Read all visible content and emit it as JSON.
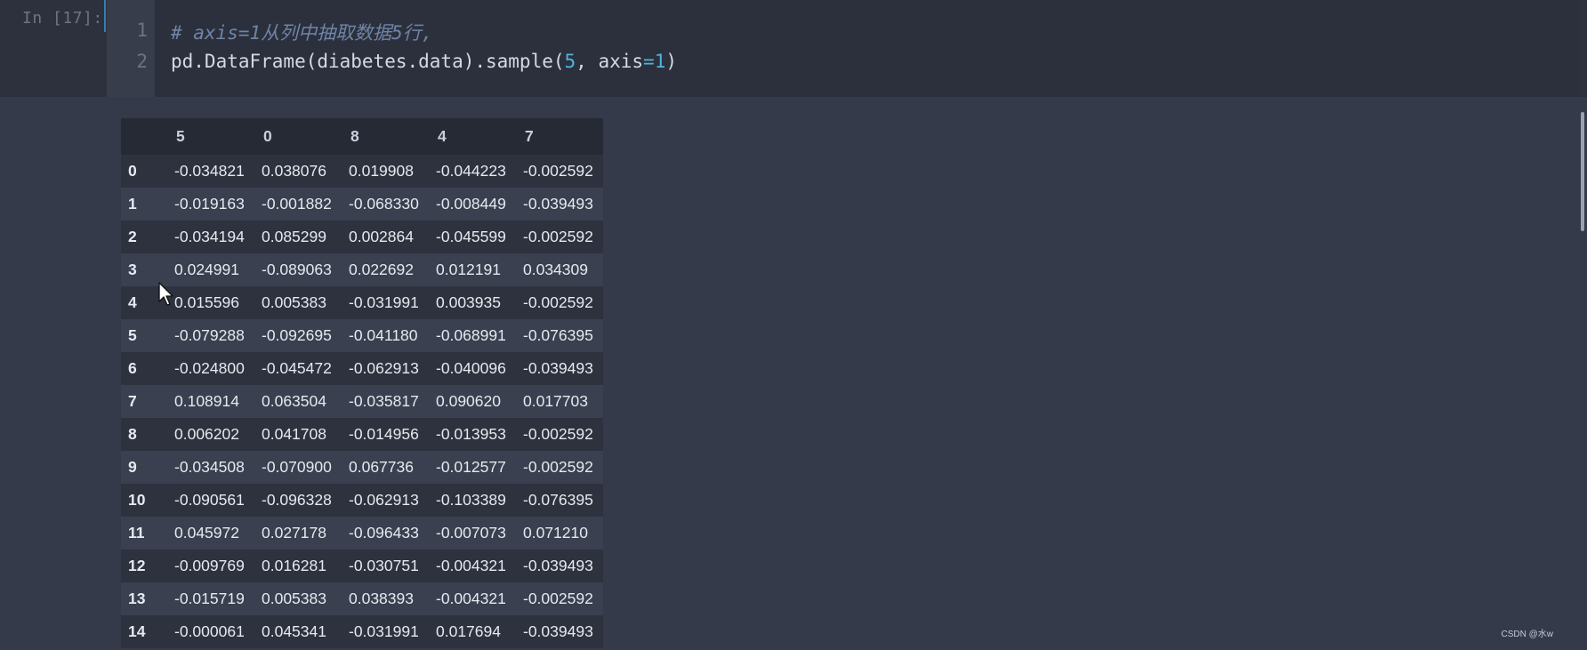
{
  "prompt": "In [17]:",
  "code": {
    "line_numbers": [
      "1",
      "2"
    ],
    "line1_comment": "# axis=1从列中抽取数据5行,",
    "line2": {
      "pre": "pd.DataFrame(diabetes.data).sample(",
      "arg1": "5",
      "mid": ", axis",
      "eq": "=",
      "arg2": "1",
      "post": ")"
    }
  },
  "table": {
    "columns": [
      "",
      "5",
      "0",
      "8",
      "4",
      "7"
    ],
    "rows": [
      {
        "index": "0",
        "values": [
          "-0.034821",
          "0.038076",
          "0.019908",
          "-0.044223",
          "-0.002592"
        ]
      },
      {
        "index": "1",
        "values": [
          "-0.019163",
          "-0.001882",
          "-0.068330",
          "-0.008449",
          "-0.039493"
        ]
      },
      {
        "index": "2",
        "values": [
          "-0.034194",
          "0.085299",
          "0.002864",
          "-0.045599",
          "-0.002592"
        ]
      },
      {
        "index": "3",
        "values": [
          "0.024991",
          "-0.089063",
          "0.022692",
          "0.012191",
          "0.034309"
        ]
      },
      {
        "index": "4",
        "values": [
          "0.015596",
          "0.005383",
          "-0.031991",
          "0.003935",
          "-0.002592"
        ]
      },
      {
        "index": "5",
        "values": [
          "-0.079288",
          "-0.092695",
          "-0.041180",
          "-0.068991",
          "-0.076395"
        ]
      },
      {
        "index": "6",
        "values": [
          "-0.024800",
          "-0.045472",
          "-0.062913",
          "-0.040096",
          "-0.039493"
        ]
      },
      {
        "index": "7",
        "values": [
          "0.108914",
          "0.063504",
          "-0.035817",
          "0.090620",
          "0.017703"
        ]
      },
      {
        "index": "8",
        "values": [
          "0.006202",
          "0.041708",
          "-0.014956",
          "-0.013953",
          "-0.002592"
        ]
      },
      {
        "index": "9",
        "values": [
          "-0.034508",
          "-0.070900",
          "0.067736",
          "-0.012577",
          "-0.002592"
        ]
      },
      {
        "index": "10",
        "values": [
          "-0.090561",
          "-0.096328",
          "-0.062913",
          "-0.103389",
          "-0.076395"
        ]
      },
      {
        "index": "11",
        "values": [
          "0.045972",
          "0.027178",
          "-0.096433",
          "-0.007073",
          "0.071210"
        ]
      },
      {
        "index": "12",
        "values": [
          "-0.009769",
          "0.016281",
          "-0.030751",
          "-0.004321",
          "-0.039493"
        ]
      },
      {
        "index": "13",
        "values": [
          "-0.015719",
          "0.005383",
          "0.038393",
          "-0.004321",
          "-0.002592"
        ]
      },
      {
        "index": "14",
        "values": [
          "-0.000061",
          "0.045341",
          "-0.031991",
          "0.017694",
          "-0.039493"
        ]
      }
    ]
  },
  "watermark": "CSDN @水w",
  "colors": {
    "background": "#343a49",
    "code_background": "#2b303c",
    "comment": "#6f84a8",
    "number": "#4fb3e0",
    "cell_marker": "#2f7fb6"
  },
  "icons": [
    "mouse-pointer-icon"
  ]
}
